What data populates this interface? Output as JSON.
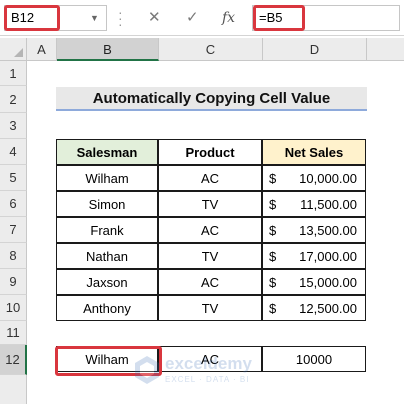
{
  "formula_bar": {
    "name_box": "B12",
    "formula": "=B5",
    "cancel_icon": "✕",
    "enter_icon": "✓",
    "fx_label": "fx"
  },
  "columns": [
    "A",
    "B",
    "C",
    "D"
  ],
  "rows": [
    "1",
    "2",
    "3",
    "4",
    "5",
    "6",
    "7",
    "8",
    "9",
    "10",
    "11",
    "12"
  ],
  "title": "Automatically Copying Cell Value",
  "table": {
    "headers": [
      "Salesman",
      "Product",
      "Net Sales"
    ],
    "currency_symbol": "$",
    "rows": [
      {
        "salesman": "Wilham",
        "product": "AC",
        "sales": "10,000.00"
      },
      {
        "salesman": "Simon",
        "product": "TV",
        "sales": "11,500.00"
      },
      {
        "salesman": "Frank",
        "product": "AC",
        "sales": "13,500.00"
      },
      {
        "salesman": "Nathan",
        "product": "TV",
        "sales": "17,000.00"
      },
      {
        "salesman": "Jaxson",
        "product": "AC",
        "sales": "15,000.00"
      },
      {
        "salesman": "Anthony",
        "product": "TV",
        "sales": "12,500.00"
      }
    ]
  },
  "copied_row": {
    "salesman": "Wilham",
    "product": "AC",
    "sales": "10000"
  },
  "watermark": {
    "name": "exceldemy",
    "tagline": "EXCEL · DATA · BI"
  },
  "colors": {
    "accent_red": "#d9363e",
    "header_green": "#e2efda",
    "header_orange": "#fff2cc"
  }
}
